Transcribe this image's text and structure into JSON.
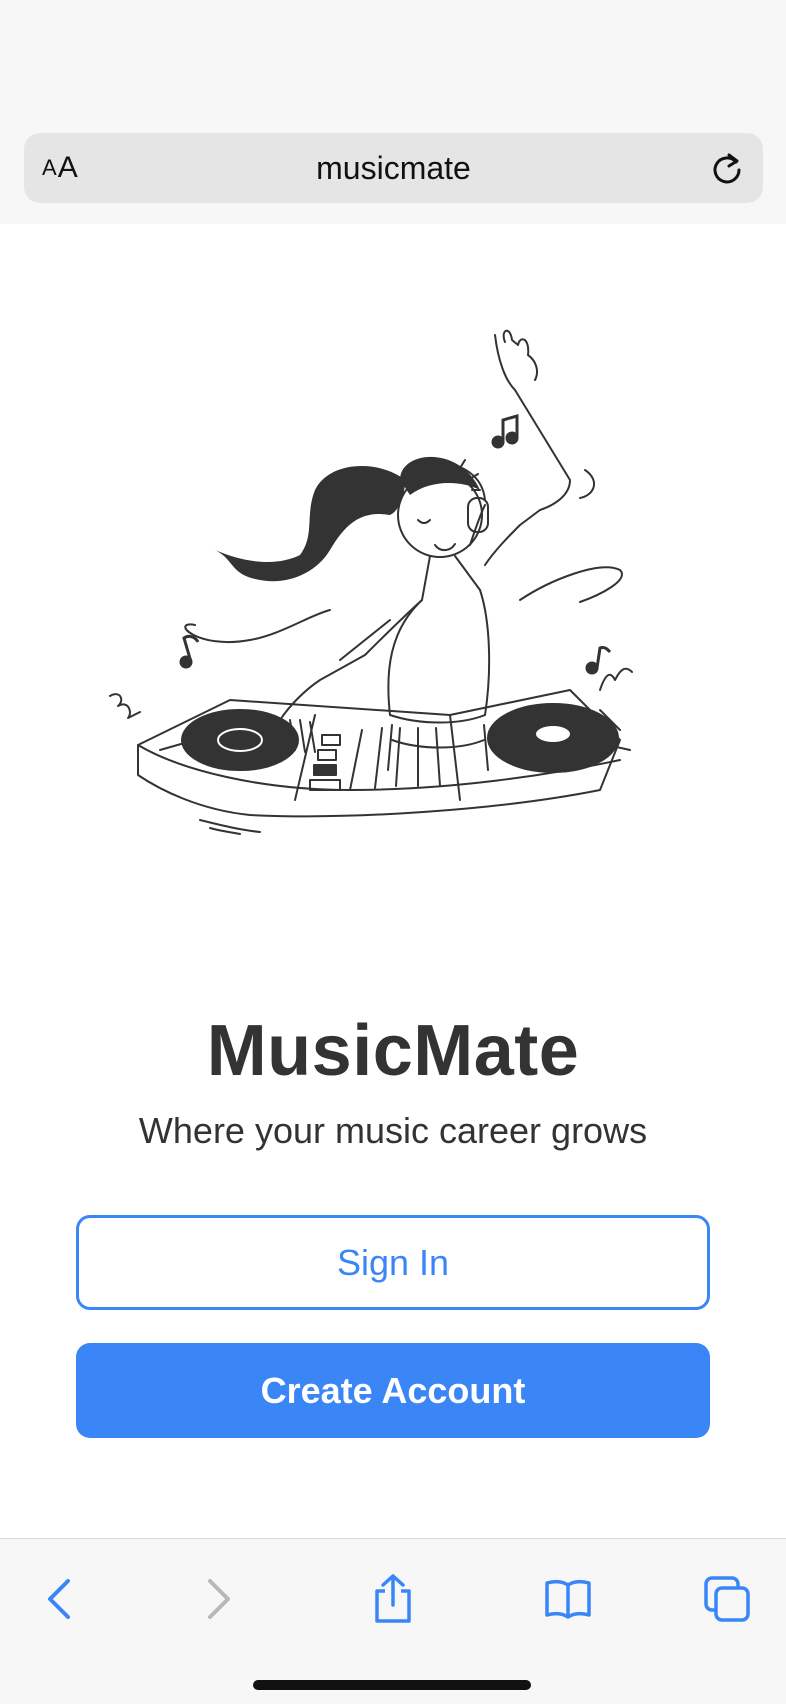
{
  "browser": {
    "text_size_button": {
      "small": "A",
      "large": "A"
    },
    "url": "musicmate",
    "reload_icon": "reload-icon"
  },
  "hero": {
    "illustration": "dj-girl-illustration"
  },
  "app": {
    "title": "MusicMate",
    "tagline": "Where your music career grows"
  },
  "actions": {
    "sign_in_label": "Sign In",
    "create_account_label": "Create Account"
  },
  "toolbar": {
    "back_icon": "chevron-left-icon",
    "forward_icon": "chevron-right-icon",
    "share_icon": "share-icon",
    "bookmarks_icon": "book-icon",
    "tabs_icon": "tabs-icon"
  },
  "colors": {
    "accent": "#3b86f7",
    "text": "#333333",
    "toolbar_bg": "#f7f7f7",
    "url_bg": "#e5e5e5",
    "disabled": "#b8b8b8"
  }
}
